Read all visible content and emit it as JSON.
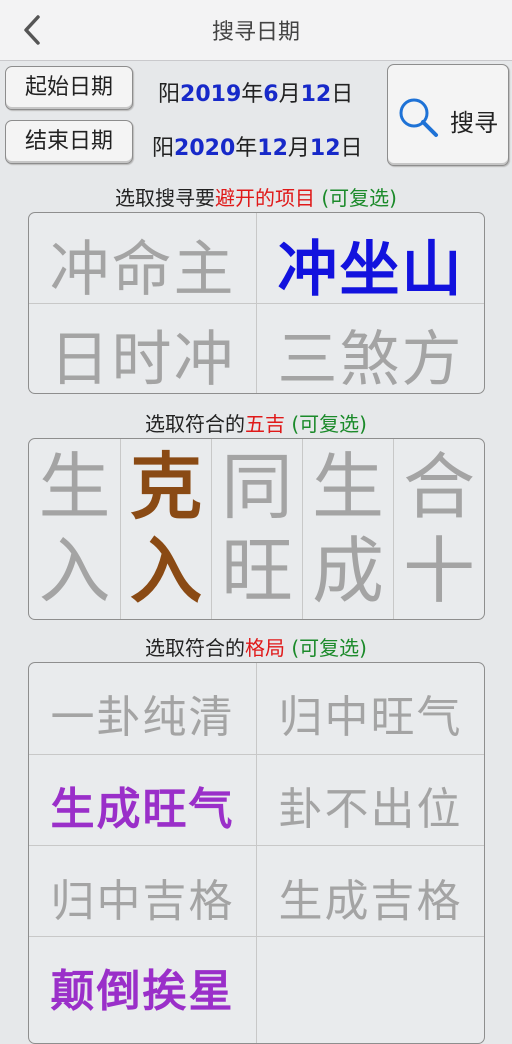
{
  "header": {
    "title": "搜寻日期",
    "back_icon": "chevron-left-icon"
  },
  "dates": {
    "start_label": "起始日期",
    "start_prefix": "阳",
    "start_year": "2019",
    "start_month": "6",
    "start_day": "12",
    "end_label": "结束日期",
    "end_prefix": "阳",
    "end_year": "2020",
    "end_month": "12",
    "end_day": "12",
    "unit_year": "年",
    "unit_month": "月",
    "unit_day": "日"
  },
  "search": {
    "label": "搜寻",
    "icon": "search-icon"
  },
  "avoid_section": {
    "caption_prefix": "选取搜寻要",
    "caption_highlight": "避开的项目",
    "caption_option": " (可复选)",
    "items": [
      {
        "label": "冲命主",
        "selected": false
      },
      {
        "label": "冲坐山",
        "selected": true
      },
      {
        "label": "日时冲",
        "selected": false
      },
      {
        "label": "三煞方",
        "selected": false
      }
    ]
  },
  "wuji_section": {
    "caption_prefix": "选取符合的",
    "caption_highlight": "五吉",
    "caption_option": " (可复选)",
    "items": [
      {
        "top": "生",
        "bottom": "入",
        "selected": false
      },
      {
        "top": "克",
        "bottom": "入",
        "selected": true
      },
      {
        "top": "同",
        "bottom": "旺",
        "selected": false
      },
      {
        "top": "生",
        "bottom": "成",
        "selected": false
      },
      {
        "top": "合",
        "bottom": "十",
        "selected": false
      }
    ]
  },
  "geju_section": {
    "caption_prefix": "选取符合的",
    "caption_highlight": "格局",
    "caption_option": " (可复选)",
    "items": [
      {
        "label": "一卦纯清",
        "selected": false
      },
      {
        "label": "归中旺气",
        "selected": false
      },
      {
        "label": "生成旺气",
        "selected": true
      },
      {
        "label": "卦不出位",
        "selected": false
      },
      {
        "label": "归中吉格",
        "selected": false
      },
      {
        "label": "生成吉格",
        "selected": false
      },
      {
        "label": "颠倒挨星",
        "selected": true
      }
    ]
  },
  "colors": {
    "selected_blue": "#1212de",
    "selected_brown": "#8a4a14",
    "selected_purple": "#9a2fc9",
    "unselected": "#a4a4a4",
    "highlight_red": "#e01919",
    "option_green": "#1b8a2a"
  }
}
